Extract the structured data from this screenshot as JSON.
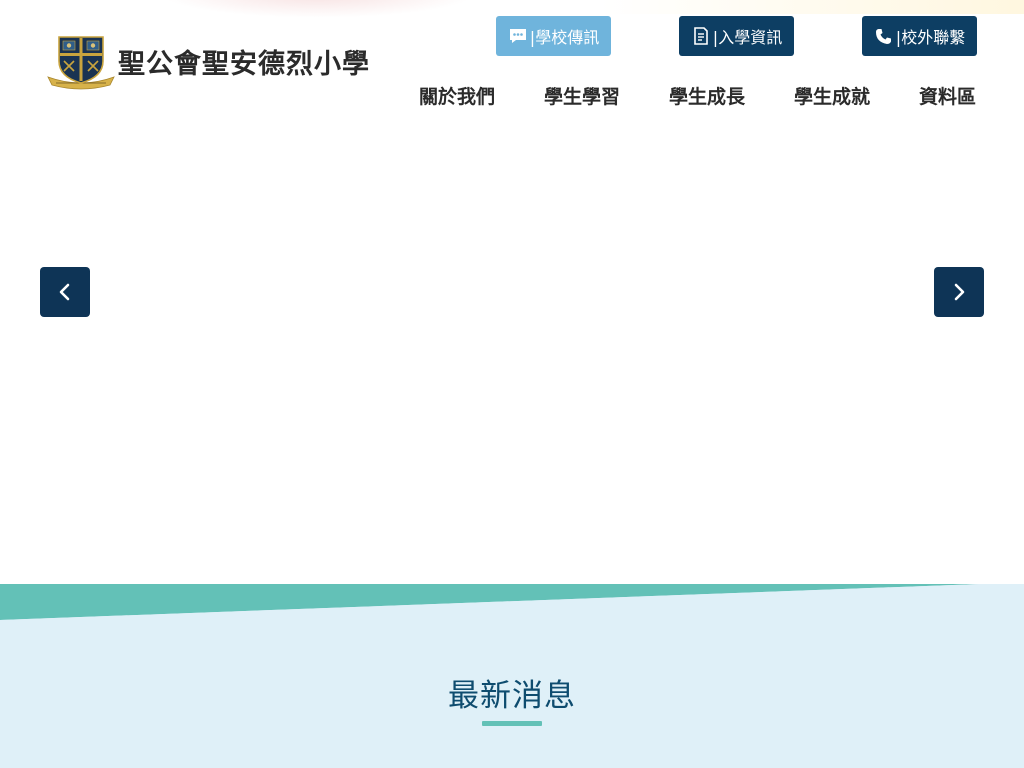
{
  "header": {
    "school_name": "聖公會聖安德烈小學",
    "buttons": [
      {
        "label": "|學校傳訊",
        "icon": "message-icon",
        "color": "#6fb4dc"
      },
      {
        "label": "|入學資訊",
        "icon": "document-icon",
        "color": "#0d3e63"
      },
      {
        "label": "|校外聯繫",
        "icon": "phone-icon",
        "color": "#0d3e63"
      }
    ],
    "nav": [
      {
        "label": "關於我們"
      },
      {
        "label": "學生學習"
      },
      {
        "label": "學生成長"
      },
      {
        "label": "學生成就"
      },
      {
        "label": "資料區"
      }
    ]
  },
  "carousel": {
    "prev_icon": "chevron-left-icon",
    "next_icon": "chevron-right-icon",
    "arrow_color": "#0e3456"
  },
  "news": {
    "title": "最新消息",
    "band_color": "#63c1b7",
    "background_color": "#dff0f8"
  }
}
